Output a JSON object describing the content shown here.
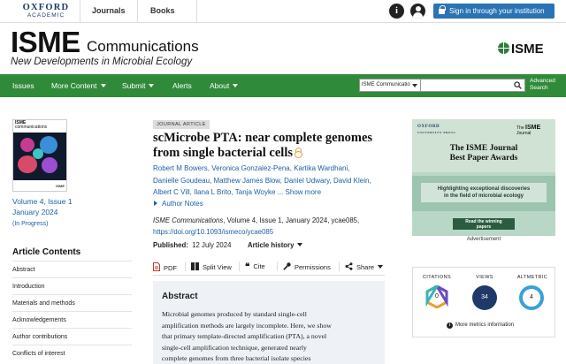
{
  "header": {
    "publisher_line1": "OXFORD",
    "publisher_line2": "ACADEMIC",
    "journals_link": "Journals",
    "books_link": "Books",
    "signin_label": "Sign in through your institution"
  },
  "masthead": {
    "journal_short": "ISME",
    "journal_word": "Communications",
    "subtitle": "New Developments in Microbial Ecology",
    "society_logo": "ISME"
  },
  "nav": {
    "items": [
      {
        "label": "Issues"
      },
      {
        "label": "More Content"
      },
      {
        "label": "Submit"
      },
      {
        "label": "Alerts"
      },
      {
        "label": "About"
      }
    ],
    "search_scope": "ISME Communicatio",
    "advanced_search_line1": "Advanced",
    "advanced_search_line2": "Search"
  },
  "issue": {
    "cover_title": "ISME",
    "cover_sub": "communications",
    "cover_footer": "ISME",
    "volume_line1": "Volume 4, Issue 1",
    "volume_line2": "January 2024",
    "status": "(In Progress)"
  },
  "contents": {
    "title": "Article Contents",
    "items": [
      "Abstract",
      "Introduction",
      "Materials and methods",
      "Acknowledgements",
      "Author contributions",
      "Conflicts of interest"
    ]
  },
  "article": {
    "type_badge": "JOURNAL ARTICLE",
    "title": "scMicrobe PTA: near complete genomes from single bacterial cells",
    "authors_line1": "Robert M Bowers, Veronica Gonzalez-Pena, Kartika Wardhani,",
    "authors_line2": "Danielle Goudeau, Matthew James Blow, Daniel Udwary, David Klein,",
    "authors_line3": "Albert C Vill, Ilana L Brito, Tanja Woyke ... Show more",
    "author_notes": "Author Notes",
    "citation_journal": "ISME Communications",
    "citation_rest": ", Volume 4, Issue 1, January 2024, ycae085,",
    "doi": "https://doi.org/10.1093/ismeco/ycae085",
    "published_label": "Published:",
    "published_date": "12 July 2024",
    "history_label": "Article history"
  },
  "tools": {
    "pdf": "PDF",
    "split_view": "Split View",
    "cite": "Cite",
    "permissions": "Permissions",
    "share": "Share"
  },
  "abstract": {
    "heading": "Abstract",
    "line1": "Microbial genomes produced by standard single-cell",
    "line2": "amplification methods are largely incomplete. Here, we show",
    "line3": "that primary template-directed amplification (PTA), a novel",
    "line4": "single-cell amplification technique, generated nearly",
    "line5": "complete genomes from three bacterial isolate species"
  },
  "ad": {
    "publisher_line1": "OXFORD",
    "publisher_line2": "UNIVERSITY PRESS",
    "journal_the": "The",
    "journal_name": "ISME",
    "journal_word": "Journal",
    "headline_line1": "The ISME Journal",
    "headline_line2": "Best Paper Awards",
    "band_line1": "Highlighting exceptional discoveries",
    "band_line2": "in the field of microbial ecology",
    "button_line1": "Read the winning",
    "button_line2": "papers",
    "label": "Advertisement"
  },
  "metrics": {
    "citations_label": "CITATIONS",
    "citations_value": "0",
    "views_label": "VIEWS",
    "views_value": "34",
    "altmetric_label": "ALTMETRIC",
    "altmetric_value": "4",
    "more_label": "More metrics information"
  },
  "colors": {
    "nav_green": "#2f8a3a",
    "signin_blue": "#2a73b4",
    "link_blue": "#1d5fa8",
    "views_navy": "#1f3a68",
    "altmetric_blue": "#3aa0d8"
  }
}
